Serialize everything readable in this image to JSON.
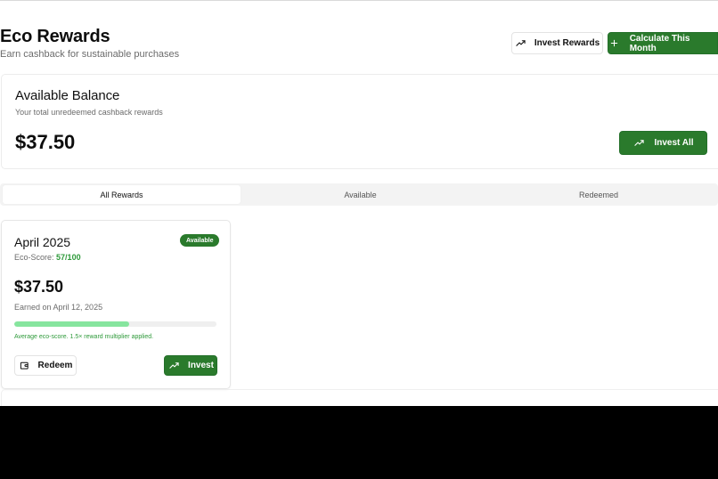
{
  "header": {
    "title": "Eco Rewards",
    "subtitle": "Earn cashback for sustainable purchases",
    "invest_rewards_label": "Invest Rewards",
    "calculate_label": "Calculate This Month"
  },
  "balance": {
    "title": "Available Balance",
    "subtitle": "Your total unredeemed cashback rewards",
    "amount": "$37.50",
    "invest_all_label": "Invest All"
  },
  "tabs": [
    {
      "label": "All Rewards",
      "active": true
    },
    {
      "label": "Available",
      "active": false
    },
    {
      "label": "Redeemed",
      "active": false
    }
  ],
  "rewards": [
    {
      "month": "April 2025",
      "status": "Available",
      "eco_label": "Eco-Score:",
      "eco_score": "57/100",
      "amount": "$37.50",
      "earned": "Earned on April 12, 2025",
      "progress": 0.57,
      "note": "Average eco-score. 1.5× reward multiplier applied.",
      "redeem_label": "Redeem",
      "invest_label": "Invest"
    }
  ],
  "colors": {
    "accent": "#2a7a2c",
    "score_text": "#2e9a3a",
    "progress_fill": "#86e59e"
  },
  "icons": {
    "trend": "trending-up-icon",
    "plus": "plus-icon",
    "wallet": "wallet-icon"
  }
}
